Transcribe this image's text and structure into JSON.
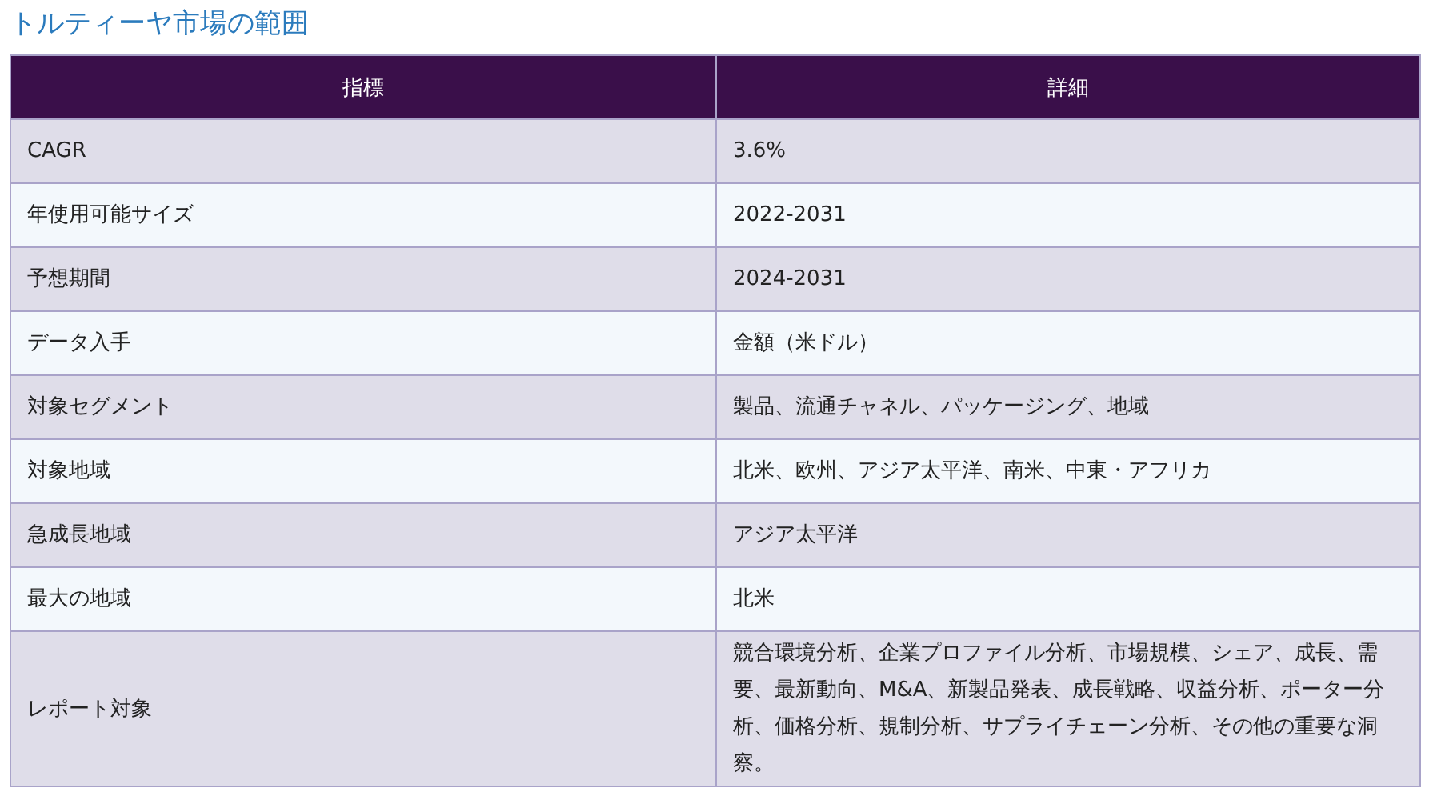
{
  "title": "トルティーヤ市場の範囲",
  "table": {
    "columns": [
      "指標",
      "詳細"
    ],
    "rows": [
      {
        "metric": "CAGR",
        "detail": "3.6%"
      },
      {
        "metric": "年使用可能サイズ",
        "detail": "2022-2031"
      },
      {
        "metric": "予想期間",
        "detail": "2024-2031"
      },
      {
        "metric": "データ入手",
        "detail": "金額（米ドル）"
      },
      {
        "metric": "対象セグメント",
        "detail": "製品、流通チャネル、パッケージング、地域"
      },
      {
        "metric": "対象地域",
        "detail": "北米、欧州、アジア太平洋、南米、中東・アフリカ"
      },
      {
        "metric": "急成長地域",
        "detail": "アジア太平洋"
      },
      {
        "metric": "最大の地域",
        "detail": "北米"
      },
      {
        "metric": "レポート対象",
        "detail": "競合環境分析、企業プロファイル分析、市場規模、シェア、成長、需要、最新動向、M&A、新製品発表、成長戦略、収益分析、ポーター分析、価格分析、規制分析、サプライチェーン分析、その他の重要な洞察。"
      }
    ]
  }
}
